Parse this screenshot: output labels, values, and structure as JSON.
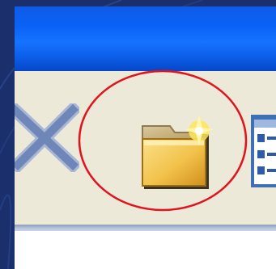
{
  "window": {
    "title_bar_color": "#0a62f5",
    "toolbar_color": "#ece9d8"
  },
  "toolbar": {
    "buttons": [
      {
        "id": "delete",
        "icon": "delete-x-icon",
        "color": "#6f86b8"
      },
      {
        "id": "new_folder",
        "icon": "new-folder-icon",
        "color": "#f0c24a"
      },
      {
        "id": "views",
        "icon": "views-icon",
        "color": "#3f6fb5"
      }
    ]
  },
  "annotation": {
    "shape": "circle",
    "color": "#e0141e",
    "target": "new_folder"
  },
  "colors": {
    "slide_background": "#1b2f6c",
    "toolbar_border": "#9aadc9"
  }
}
